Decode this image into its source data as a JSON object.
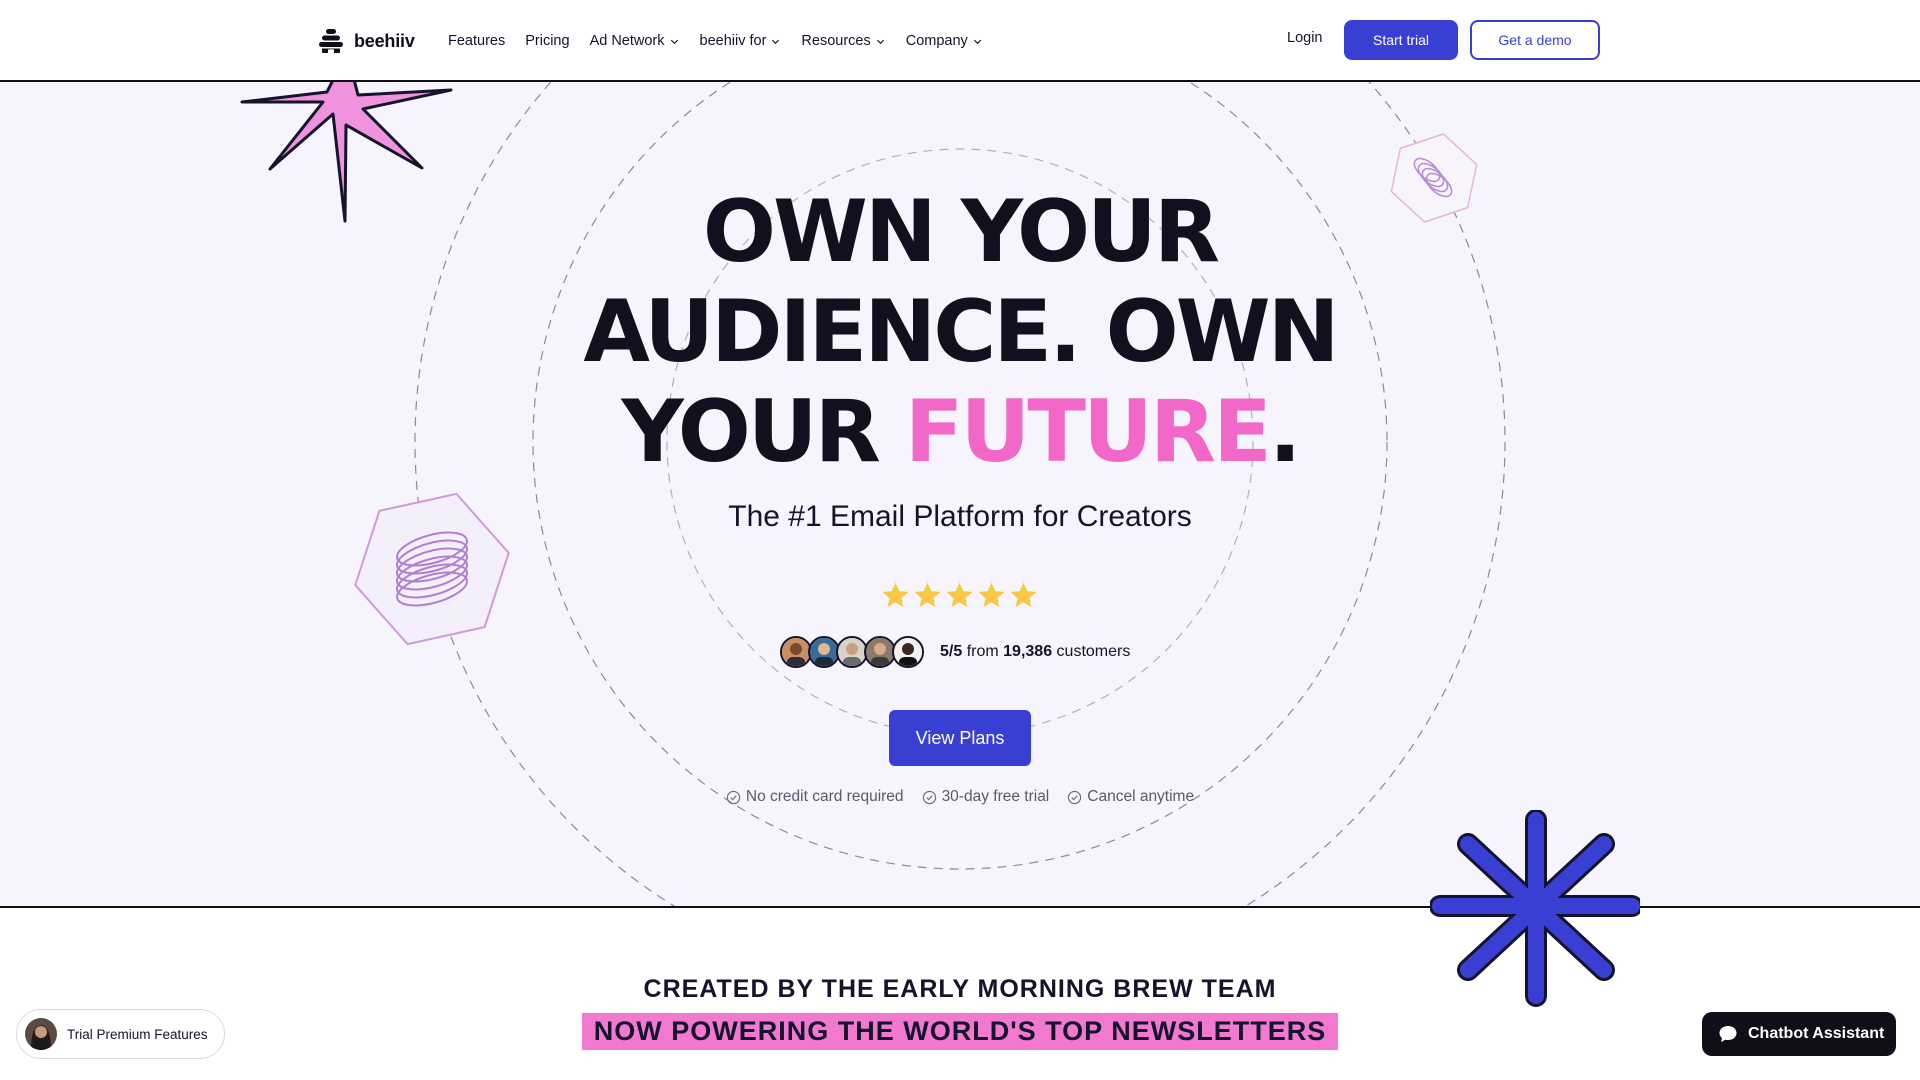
{
  "nav": {
    "logo_text": "beehiiv",
    "links": [
      {
        "label": "Features",
        "has_dropdown": false
      },
      {
        "label": "Pricing",
        "has_dropdown": false
      },
      {
        "label": "Ad Network",
        "has_dropdown": true
      },
      {
        "label": "beehiiv for",
        "has_dropdown": true
      },
      {
        "label": "Resources",
        "has_dropdown": true
      },
      {
        "label": "Company",
        "has_dropdown": true
      }
    ],
    "login_label": "Login",
    "start_trial_label": "Start trial",
    "demo_label": "Get a demo"
  },
  "hero": {
    "headline_line1": "OWN YOUR",
    "headline_line2": "AUDIENCE. OWN",
    "headline_line3_prefix": "YOUR ",
    "headline_highlight": "FUTURE",
    "headline_suffix": ".",
    "subtitle": "The #1 Email Platform for Creators",
    "rating_stars": 5,
    "rating_value": "5/5",
    "rating_from": "from",
    "customer_count": "19,386",
    "customers_label": "customers",
    "cta_label": "View Plans",
    "perks": [
      "No credit card required",
      "30-day free trial",
      "Cancel anytime"
    ]
  },
  "section": {
    "tagline1": "CREATED BY THE EARLY MORNING BREW TEAM",
    "tagline2": "NOW POWERING THE WORLD'S TOP NEWSLETTERS"
  },
  "widgets": {
    "trial_pill_label": "Trial Premium Features",
    "chatbot_label": "Chatbot Assistant"
  },
  "colors": {
    "accent_blue": "#3a3fd4",
    "highlight_pink": "#f268c9",
    "hero_bg": "#f6f4fc",
    "star_yellow": "#f7c948",
    "dark": "#0f0f1a"
  },
  "icons": {
    "logo": "beehive-icon",
    "dropdown": "chevron-down-icon",
    "perk": "check-circle-icon",
    "chat": "chat-bubble-icon"
  }
}
